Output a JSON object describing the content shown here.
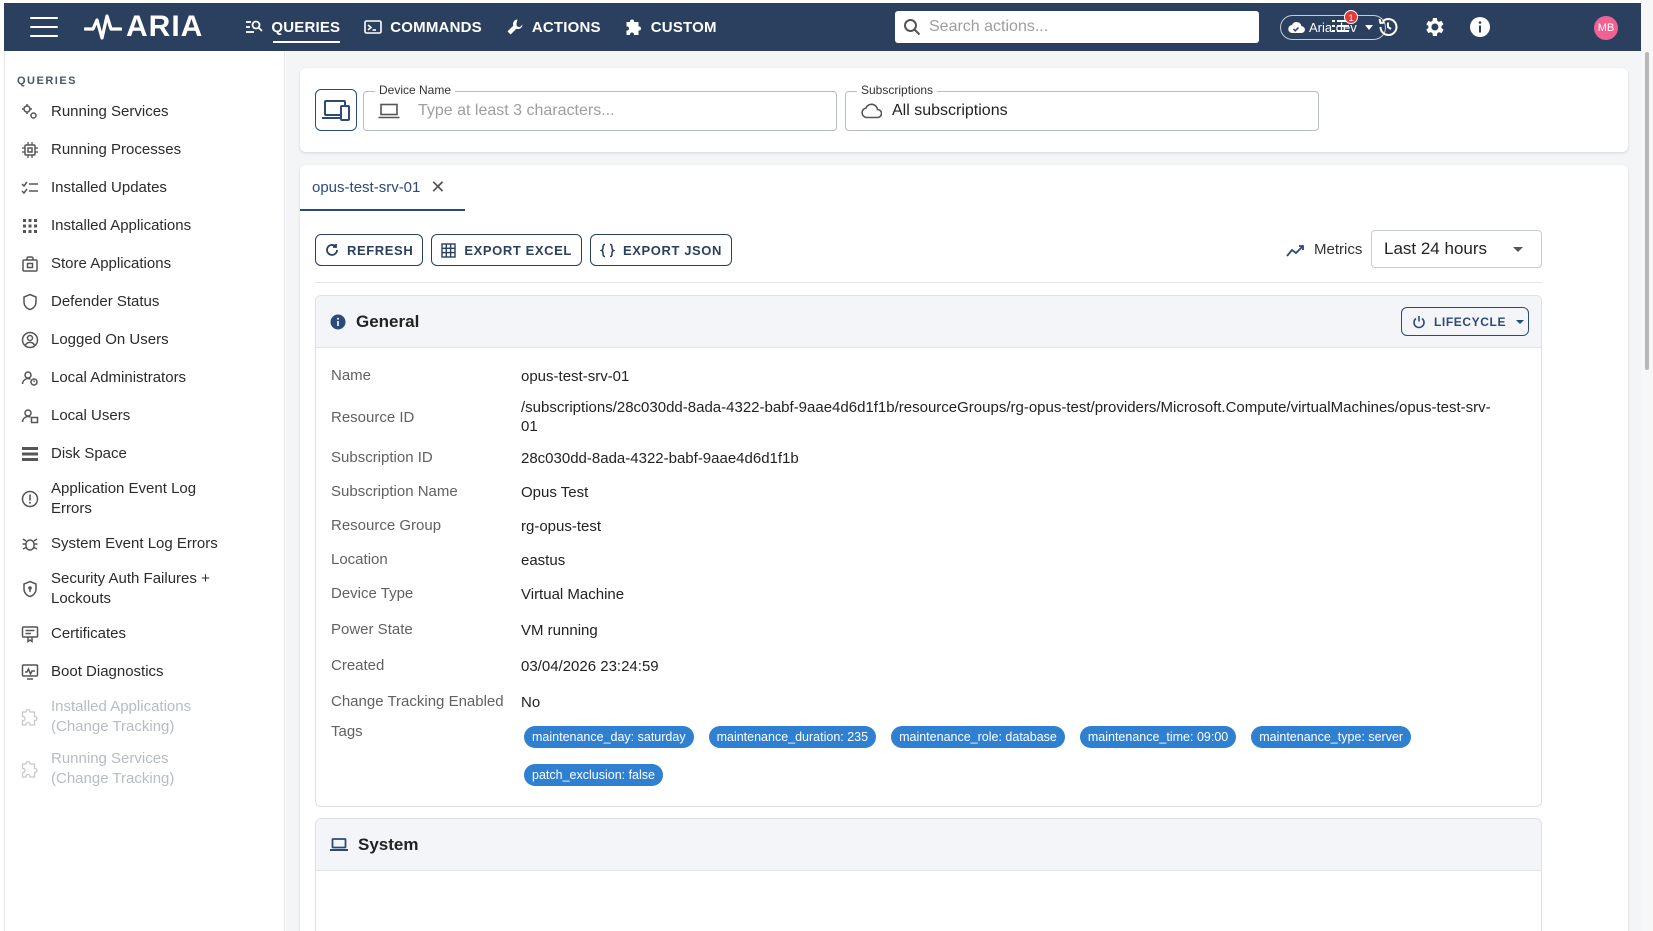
{
  "app": {
    "name": "ARIA",
    "nav": [
      {
        "label": "QUERIES",
        "icon": "queries-icon",
        "active": true
      },
      {
        "label": "COMMANDS",
        "icon": "terminal-icon",
        "active": false
      },
      {
        "label": "ACTIONS",
        "icon": "wrench-icon",
        "active": false
      },
      {
        "label": "CUSTOM",
        "icon": "puzzle-icon",
        "active": false
      }
    ],
    "search_placeholder": "Search actions...",
    "environment": "Aria.dev",
    "notification_count": "1",
    "user_initials": "MB",
    "accent_color": "#2b3f5f"
  },
  "sidebar": {
    "title": "QUERIES",
    "items": [
      {
        "label": "Running Services",
        "icon": "gears-icon",
        "disabled": false
      },
      {
        "label": "Running Processes",
        "icon": "chip-icon",
        "disabled": false
      },
      {
        "label": "Installed Updates",
        "icon": "checklist-icon",
        "disabled": false
      },
      {
        "label": "Installed Applications",
        "icon": "apps-grid-icon",
        "disabled": false
      },
      {
        "label": "Store Applications",
        "icon": "store-icon",
        "disabled": false
      },
      {
        "label": "Defender Status",
        "icon": "shield-icon",
        "disabled": false
      },
      {
        "label": "Logged On Users",
        "icon": "user-circle-icon",
        "disabled": false
      },
      {
        "label": "Local Administrators",
        "icon": "admin-icon",
        "disabled": false
      },
      {
        "label": "Local Users",
        "icon": "users-icon",
        "disabled": false
      },
      {
        "label": "Disk Space",
        "icon": "storage-icon",
        "disabled": false
      },
      {
        "label": "Application Event Log Errors",
        "icon": "error-circle-icon",
        "disabled": false
      },
      {
        "label": "System Event Log Errors",
        "icon": "bug-icon",
        "disabled": false
      },
      {
        "label": "Security Auth Failures + Lockouts",
        "icon": "security-icon",
        "disabled": false
      },
      {
        "label": "Certificates",
        "icon": "certificate-icon",
        "disabled": false
      },
      {
        "label": "Boot Diagnostics",
        "icon": "monitor-icon",
        "disabled": false
      },
      {
        "label": "Installed Applications (Change Tracking)",
        "icon": "puzzle-outline-icon",
        "disabled": true
      },
      {
        "label": "Running Services (Change Tracking)",
        "icon": "puzzle-outline-icon",
        "disabled": true
      }
    ]
  },
  "filters": {
    "device_label": "Device Name",
    "device_placeholder": "Type at least 3 characters...",
    "subs_label": "Subscriptions",
    "subs_value": "All subscriptions"
  },
  "tab": {
    "label": "opus-test-srv-01"
  },
  "toolbar": {
    "refresh": "REFRESH",
    "export_excel": "EXPORT EXCEL",
    "export_json": "EXPORT JSON",
    "metrics": "Metrics",
    "range": "Last 24 hours"
  },
  "general": {
    "title": "General",
    "lifecycle": "LIFECYCLE",
    "rows": [
      {
        "key": "Name",
        "value": "opus-test-srv-01"
      },
      {
        "key": "Resource ID",
        "value": "/subscriptions/28c030dd-8ada-4322-babf-9aae4d6d1f1b/resourceGroups/rg-opus-test/providers/Microsoft.Compute/virtualMachines/opus-test-srv-01"
      },
      {
        "key": "Subscription ID",
        "value": "28c030dd-8ada-4322-babf-9aae4d6d1f1b"
      },
      {
        "key": "Subscription Name",
        "value": "Opus Test"
      },
      {
        "key": "Resource Group",
        "value": "rg-opus-test"
      },
      {
        "key": "Location",
        "value": "eastus"
      },
      {
        "key": "Device Type",
        "value": "Virtual Machine"
      },
      {
        "key": "Power State",
        "value": "VM running"
      },
      {
        "key": "Created",
        "value": "03/04/2026 23:24:59"
      },
      {
        "key": "Change Tracking Enabled",
        "value": "No"
      }
    ],
    "tags_label": "Tags",
    "tags": [
      "maintenance_day: saturday",
      "maintenance_duration: 235",
      "maintenance_role: database",
      "maintenance_time: 09:00",
      "maintenance_type: server",
      "patch_exclusion: false"
    ]
  },
  "system": {
    "title": "System"
  }
}
